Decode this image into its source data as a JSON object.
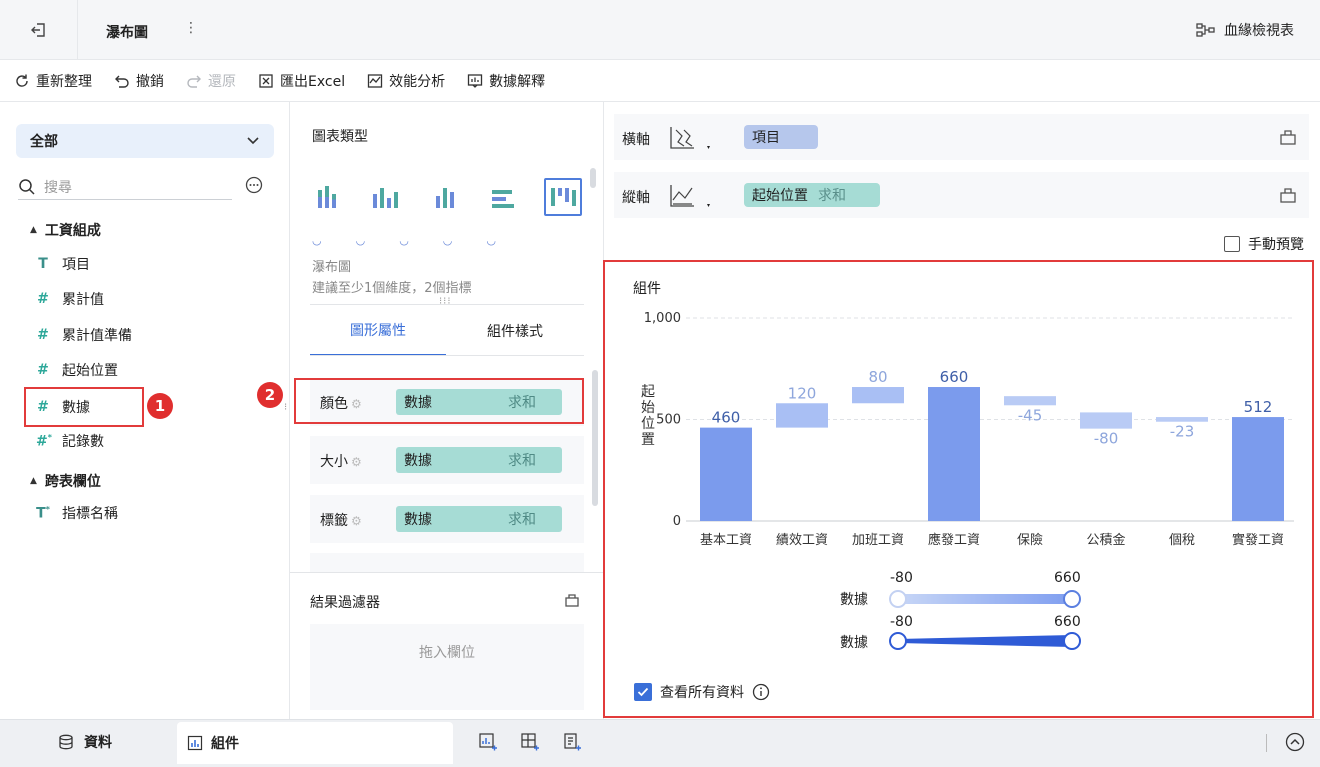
{
  "topbar": {
    "title": "瀑布圖",
    "more": "⋮",
    "lineage": "血緣檢視表"
  },
  "toolbar": {
    "refresh": "重新整理",
    "undo": "撤銷",
    "redo": "還原",
    "export": "匯出Excel",
    "perf": "效能分析",
    "explain": "數據解釋"
  },
  "left": {
    "select": "全部",
    "search_placeholder": "搜尋",
    "group1": "工資組成",
    "fields": [
      "項目",
      "累計值",
      "累計值準備",
      "起始位置",
      "數據",
      "記錄數"
    ],
    "group2": "跨表欄位",
    "cross_field": "指標名稱",
    "badge1": "1"
  },
  "mid": {
    "chart_type_title": "圖表類型",
    "chart_name": "瀑布圖",
    "chart_hint": "建議至少1個維度，2個指標",
    "tab_graph": "圖形屬性",
    "tab_style": "組件樣式",
    "badge2": "2",
    "props": [
      {
        "label": "顏色",
        "field": "數據",
        "agg": "求和"
      },
      {
        "label": "大小",
        "field": "數據",
        "agg": "求和"
      },
      {
        "label": "標籤",
        "field": "數據",
        "agg": "求和"
      }
    ],
    "filter_title": "結果過濾器",
    "filter_drop": "拖入欄位"
  },
  "right": {
    "x_axis_label": "橫軸",
    "x_field": "項目",
    "y_axis_label": "縱軸",
    "y_field": "起始位置",
    "y_agg": "求和",
    "manual_preview": "手動預覽",
    "component_title": "組件",
    "view_all": "查看所有資料"
  },
  "chart_data": {
    "type": "bar",
    "subtype": "waterfall",
    "categories": [
      "基本工資",
      "績效工資",
      "加班工資",
      "應發工資",
      "保險",
      "公積金",
      "個稅",
      "實發工資"
    ],
    "values": [
      460,
      120,
      80,
      660,
      -45,
      -80,
      -23,
      512
    ],
    "bases": [
      0,
      460,
      580,
      0,
      615,
      535,
      512,
      0
    ],
    "labels": [
      "460",
      "120",
      "80",
      "660",
      "-45",
      "-80",
      "-23",
      "512"
    ],
    "totals": [
      true,
      false,
      false,
      true,
      false,
      false,
      false,
      true
    ],
    "ylabel": "起始位置",
    "ylim": [
      0,
      1000
    ],
    "yticks": [
      "1,000",
      "500",
      "0"
    ],
    "colors": {
      "total": "#7b9bed",
      "positive": "#a9bff4",
      "negative": "#b9cbf5",
      "label_total": "#3f5fa8",
      "label_delta": "#8ea6dc"
    },
    "legend": [
      {
        "name": "數據",
        "min": "-80",
        "max": "660",
        "kind": "color"
      },
      {
        "name": "數據",
        "min": "-80",
        "max": "660",
        "kind": "size"
      }
    ]
  },
  "bottom": {
    "data_tab": "資料",
    "component_tab": "組件"
  }
}
